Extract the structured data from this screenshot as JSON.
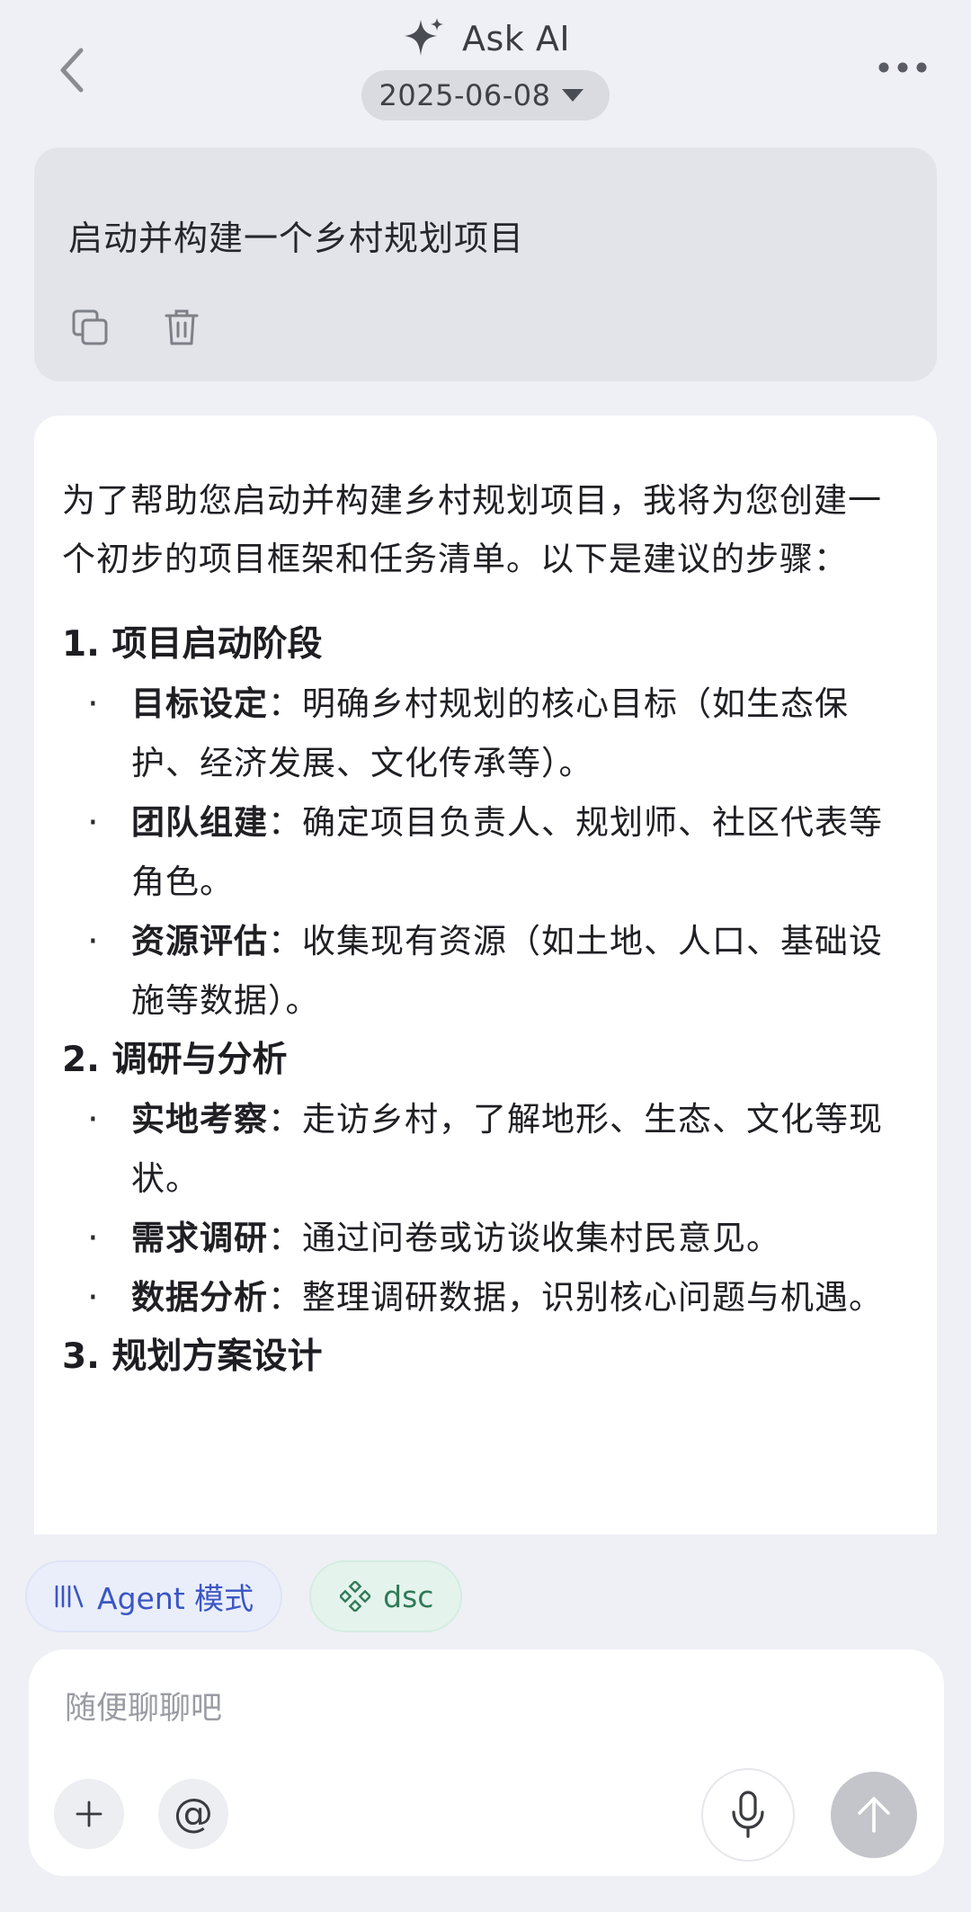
{
  "header": {
    "title": "Ask AI",
    "date": "2025-06-08"
  },
  "user_message": {
    "text": "启动并构建一个乡村规划项目"
  },
  "ai_answer": {
    "intro": "为了帮助您启动并构建乡村规划项目，我将为您创建一个初步的项目框架和任务清单。以下是建议的步骤：",
    "sections": [
      {
        "title": "1. 项目启动阶段",
        "bullets": [
          {
            "label": "目标设定",
            "text": "：明确乡村规划的核心目标（如生态保护、经济发展、文化传承等）。"
          },
          {
            "label": "团队组建",
            "text": "：确定项目负责人、规划师、社区代表等角色。"
          },
          {
            "label": "资源评估",
            "text": "：收集现有资源（如土地、人口、基础设施等数据）。"
          }
        ]
      },
      {
        "title": "2. 调研与分析",
        "bullets": [
          {
            "label": "实地考察",
            "text": "：走访乡村，了解地形、生态、文化等现状。"
          },
          {
            "label": "需求调研",
            "text": "：通过问卷或访谈收集村民意见。"
          },
          {
            "label": "数据分析",
            "text": "：整理调研数据，识别核心问题与机遇。"
          }
        ]
      },
      {
        "title": "3. 规划方案设计",
        "bullets": []
      }
    ]
  },
  "chips": {
    "agent_label": "Agent 模式",
    "dsc_label": "dsc"
  },
  "composer": {
    "placeholder": "随便聊聊吧"
  },
  "colors": {
    "background": "#eef0f5",
    "agent_chip_text": "#3a56c4",
    "dsc_chip_text": "#2f7a58",
    "send_disabled": "#c3c5cb"
  }
}
